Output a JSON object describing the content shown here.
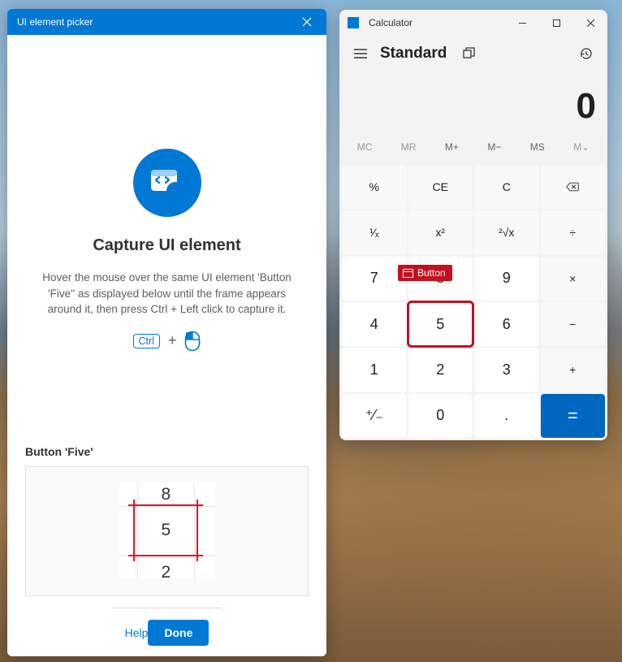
{
  "picker": {
    "title": "UI element picker",
    "hero_title": "Capture UI element",
    "hero_text": "Hover the mouse over the same UI element 'Button 'Five'' as displayed below until the frame appears around it, then press Ctrl + Left click to capture it.",
    "ctrl_label": "Ctrl",
    "preview_label": "Button 'Five'",
    "preview_digits": {
      "top": "8",
      "mid": "5",
      "bot": "2"
    },
    "help_label": "Help",
    "done_label": "Done"
  },
  "calc": {
    "app_title": "Calculator",
    "mode": "Standard",
    "display": "0",
    "memory": [
      "MC",
      "MR",
      "M+",
      "M−",
      "MS",
      "M⌄"
    ],
    "tooltip": "Button",
    "keys": {
      "percent": "%",
      "ce": "CE",
      "c": "C",
      "recip": "¹⁄ₓ",
      "square": "x²",
      "root": "²√x",
      "div": "÷",
      "n7": "7",
      "n8": "8",
      "n9": "9",
      "mul": "×",
      "n4": "4",
      "n5": "5",
      "n6": "6",
      "sub": "−",
      "n1": "1",
      "n2": "2",
      "n3": "3",
      "add": "+",
      "neg": "⁺⁄₋",
      "n0": "0",
      "dot": ".",
      "eq": "="
    }
  }
}
